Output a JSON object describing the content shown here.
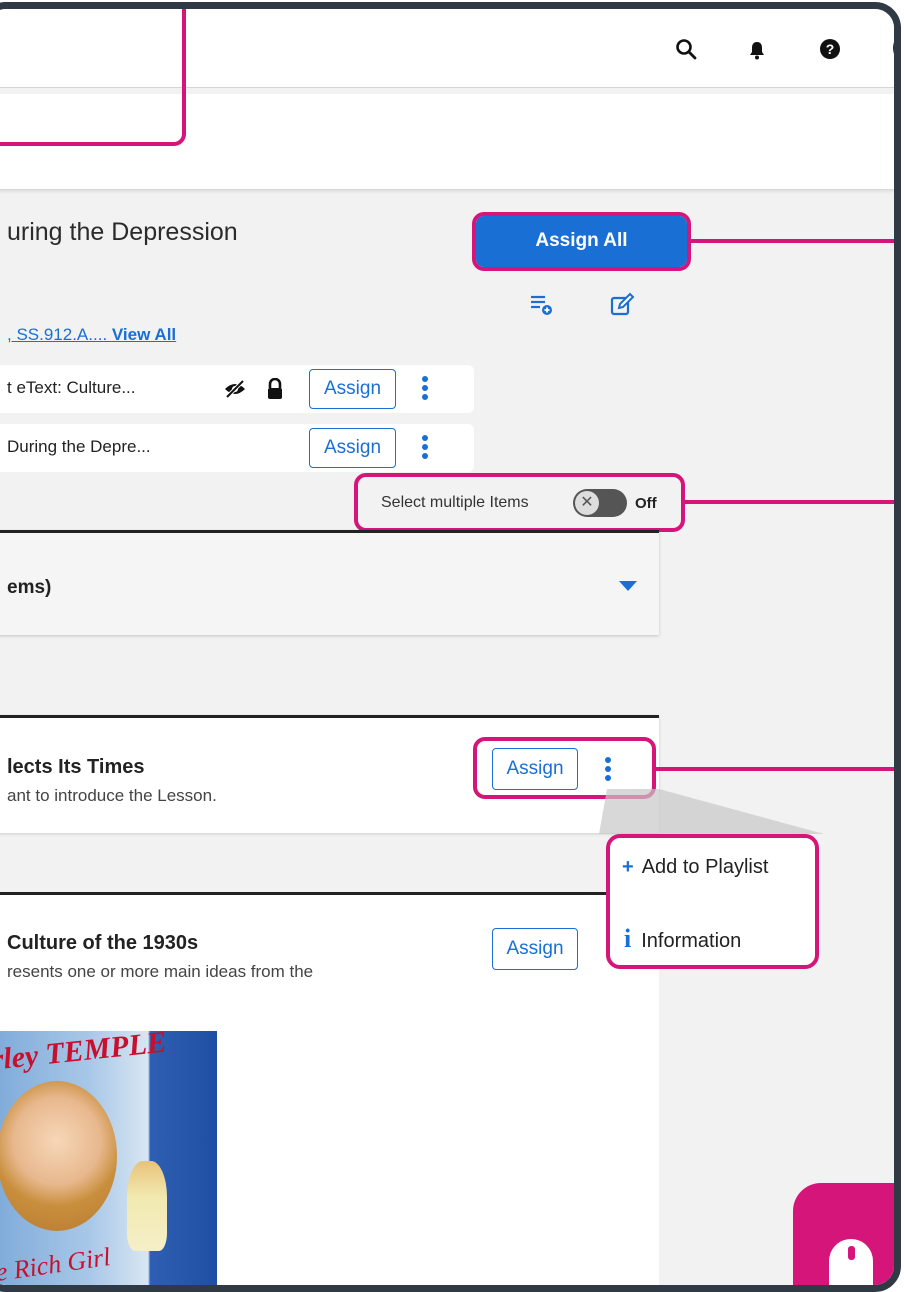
{
  "header": {
    "icons": [
      "search-icon",
      "bell-icon",
      "help-icon",
      "avatar"
    ]
  },
  "lesson": {
    "title": "uring the Depression",
    "standards_text": ", SS.912.A.... ",
    "standards_link": "View All",
    "assign_all_label": "Assign All",
    "rows": [
      {
        "text": "t eText: Culture...",
        "assign_label": "Assign"
      },
      {
        "text": "During the Depre...",
        "assign_label": "Assign"
      }
    ]
  },
  "select_multiple": {
    "label": "Select multiple Items",
    "state": "Off"
  },
  "dropdown": {
    "label": "ems)"
  },
  "items": [
    {
      "title": "lects Its Times",
      "subtitle": "ant to introduce the Lesson.",
      "assign_label": "Assign"
    },
    {
      "title": "Culture of the 1930s",
      "subtitle": "resents one or more main ideas from the",
      "assign_label": "Assign"
    }
  ],
  "menu": {
    "add_label": "Add to Playlist",
    "info_label": "Information"
  },
  "poster": {
    "top_text": "irley TEMPLE",
    "bottom_text": "tle Rich Girl"
  },
  "colors": {
    "accent": "#1a6fd4",
    "callout": "#d6157a"
  }
}
